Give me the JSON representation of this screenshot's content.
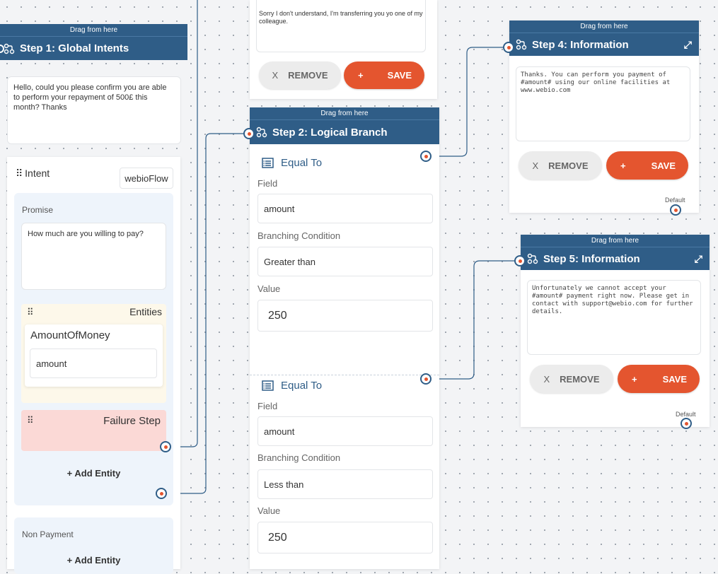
{
  "canvas": {
    "drag_handle": "Drag from here"
  },
  "step1": {
    "title": "Step 1: Global Intents",
    "message": "Hello, could you please confirm you are able to perform your repayment of 500£ this month? Thanks",
    "intent_label": "Intent",
    "intent_value": "webioFlow",
    "promise": {
      "label": "Promise",
      "question": "How much are you willing to pay?",
      "entities_label": "Entities",
      "entity_name": "AmountOfMoney",
      "entity_value": "amount",
      "failure_label": "Failure Step",
      "add_entity": "+ Add Entity"
    },
    "non_payment": {
      "label": "Non Payment",
      "add_entity": "+ Add Entity"
    }
  },
  "step_top": {
    "message": "Sorry I don't understand, I'm transferring you yo one of my colleague.",
    "remove": "REMOVE",
    "save": "SAVE"
  },
  "step2": {
    "title": "Step 2: Logical Branch",
    "conditions": [
      {
        "type": "Equal To",
        "field_label": "Field",
        "field_value": "amount",
        "condition_label": "Branching Condition",
        "condition_value": "Greater than",
        "value_label": "Value",
        "value": "250"
      },
      {
        "type": "Equal To",
        "field_label": "Field",
        "field_value": "amount",
        "condition_label": "Branching Condition",
        "condition_value": "Less than",
        "value_label": "Value",
        "value": "250"
      }
    ]
  },
  "step4": {
    "title": "Step 4: Information",
    "message": "Thanks. You can perform you payment of #amount# using our online facilities at www.webio.com",
    "remove": "REMOVE",
    "save": "SAVE",
    "default_label": "Default"
  },
  "step5": {
    "title": "Step 5: Information",
    "message": "Unfortunately we cannot accept your #amount# payment right now. Please get in contact with support@webio.com for further details.",
    "remove": "REMOVE",
    "save": "SAVE",
    "default_label": "Default"
  },
  "icons": {
    "remove": "close-icon",
    "save": "plus-icon",
    "flow": "flow-icon",
    "condition": "list-icon",
    "expand": "expand-icon"
  },
  "colors": {
    "header": "#2f5d87",
    "save": "#e4552f",
    "failure": "#fbd9d6",
    "entities": "#fdf8ea",
    "promise": "#eef4fb"
  }
}
